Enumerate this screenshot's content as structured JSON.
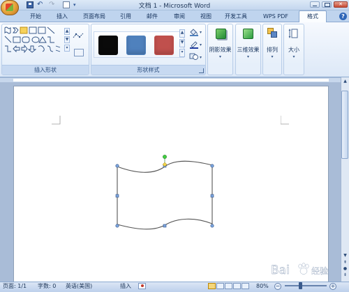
{
  "window": {
    "title": "文档 1 - Microsoft Word"
  },
  "tabs": [
    {
      "id": "home",
      "label": "开始"
    },
    {
      "id": "insert",
      "label": "插入"
    },
    {
      "id": "page-layout",
      "label": "页面布局"
    },
    {
      "id": "references",
      "label": "引用"
    },
    {
      "id": "mailings",
      "label": "邮件"
    },
    {
      "id": "review",
      "label": "审阅"
    },
    {
      "id": "view",
      "label": "视图"
    },
    {
      "id": "developer",
      "label": "开发工具"
    },
    {
      "id": "wps-pdf",
      "label": "WPS PDF"
    },
    {
      "id": "format",
      "label": "格式"
    }
  ],
  "ribbon": {
    "insert_shapes": {
      "label": "插入形状"
    },
    "shape_styles": {
      "label": "形状样式",
      "swatches": [
        {
          "name": "black-style",
          "color": "#0a0a0a"
        },
        {
          "name": "blue-style",
          "color": "#4f81bd"
        },
        {
          "name": "red-style",
          "color": "#c0504d"
        }
      ]
    },
    "shadow_effects": {
      "label": "阴影效果"
    },
    "3d_effects": {
      "label": "三维效果"
    },
    "arrange": {
      "label": "排列"
    },
    "size": {
      "label": "大小"
    }
  },
  "status": {
    "page": "页面: 1/1",
    "words": "字数: 0",
    "language": "英语(美国)",
    "mode": "插入",
    "zoom": "80%"
  },
  "watermark": {
    "text": "Bai经验"
  },
  "colors": {
    "ribbon_bg": "#dce8f7",
    "doc_bg": "#a9bcd7",
    "accent": "#4f81bd"
  }
}
